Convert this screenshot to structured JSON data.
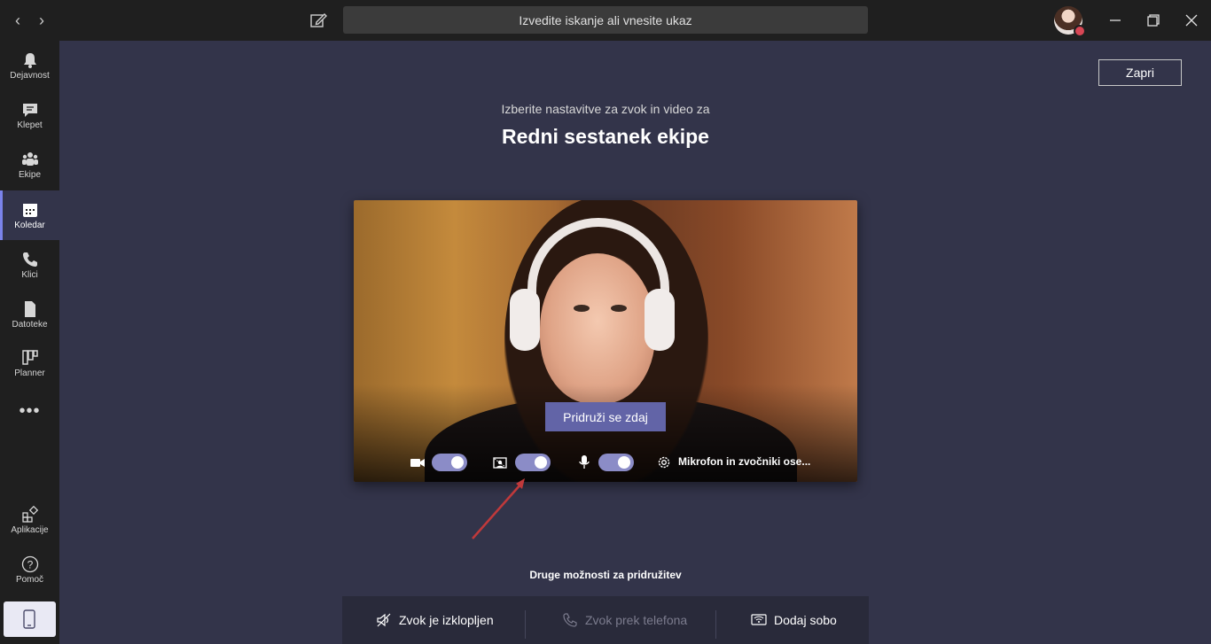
{
  "titlebar": {
    "search_placeholder": "Izvedite iskanje ali vnesite ukaz"
  },
  "rail": {
    "items": [
      {
        "label": "Dejavnost"
      },
      {
        "label": "Klepet"
      },
      {
        "label": "Ekipe"
      },
      {
        "label": "Koledar"
      },
      {
        "label": "Klici"
      },
      {
        "label": "Datoteke"
      },
      {
        "label": "Planner"
      },
      {
        "label": "Aplikacije"
      },
      {
        "label": "Pomoč"
      }
    ],
    "more": "•••"
  },
  "main": {
    "close_label": "Zapri",
    "subtitle": "Izberite nastavitve za zvok in video za",
    "meeting_title": "Redni sestanek ekipe",
    "join_label": "Pridruži se zdaj",
    "device_label": "Mikrofon in zvočniki ose...",
    "other_title": "Druge možnosti za pridružitev",
    "options": {
      "audio_off": "Zvok je izklopljen",
      "phone_audio": "Zvok prek telefona",
      "add_room": "Dodaj sobo"
    }
  },
  "colors": {
    "accent": "#6264a7",
    "toggle": "#8b8cc7",
    "background": "#33344a",
    "rail": "#1f1f1f",
    "arrow": "#c0393b"
  }
}
